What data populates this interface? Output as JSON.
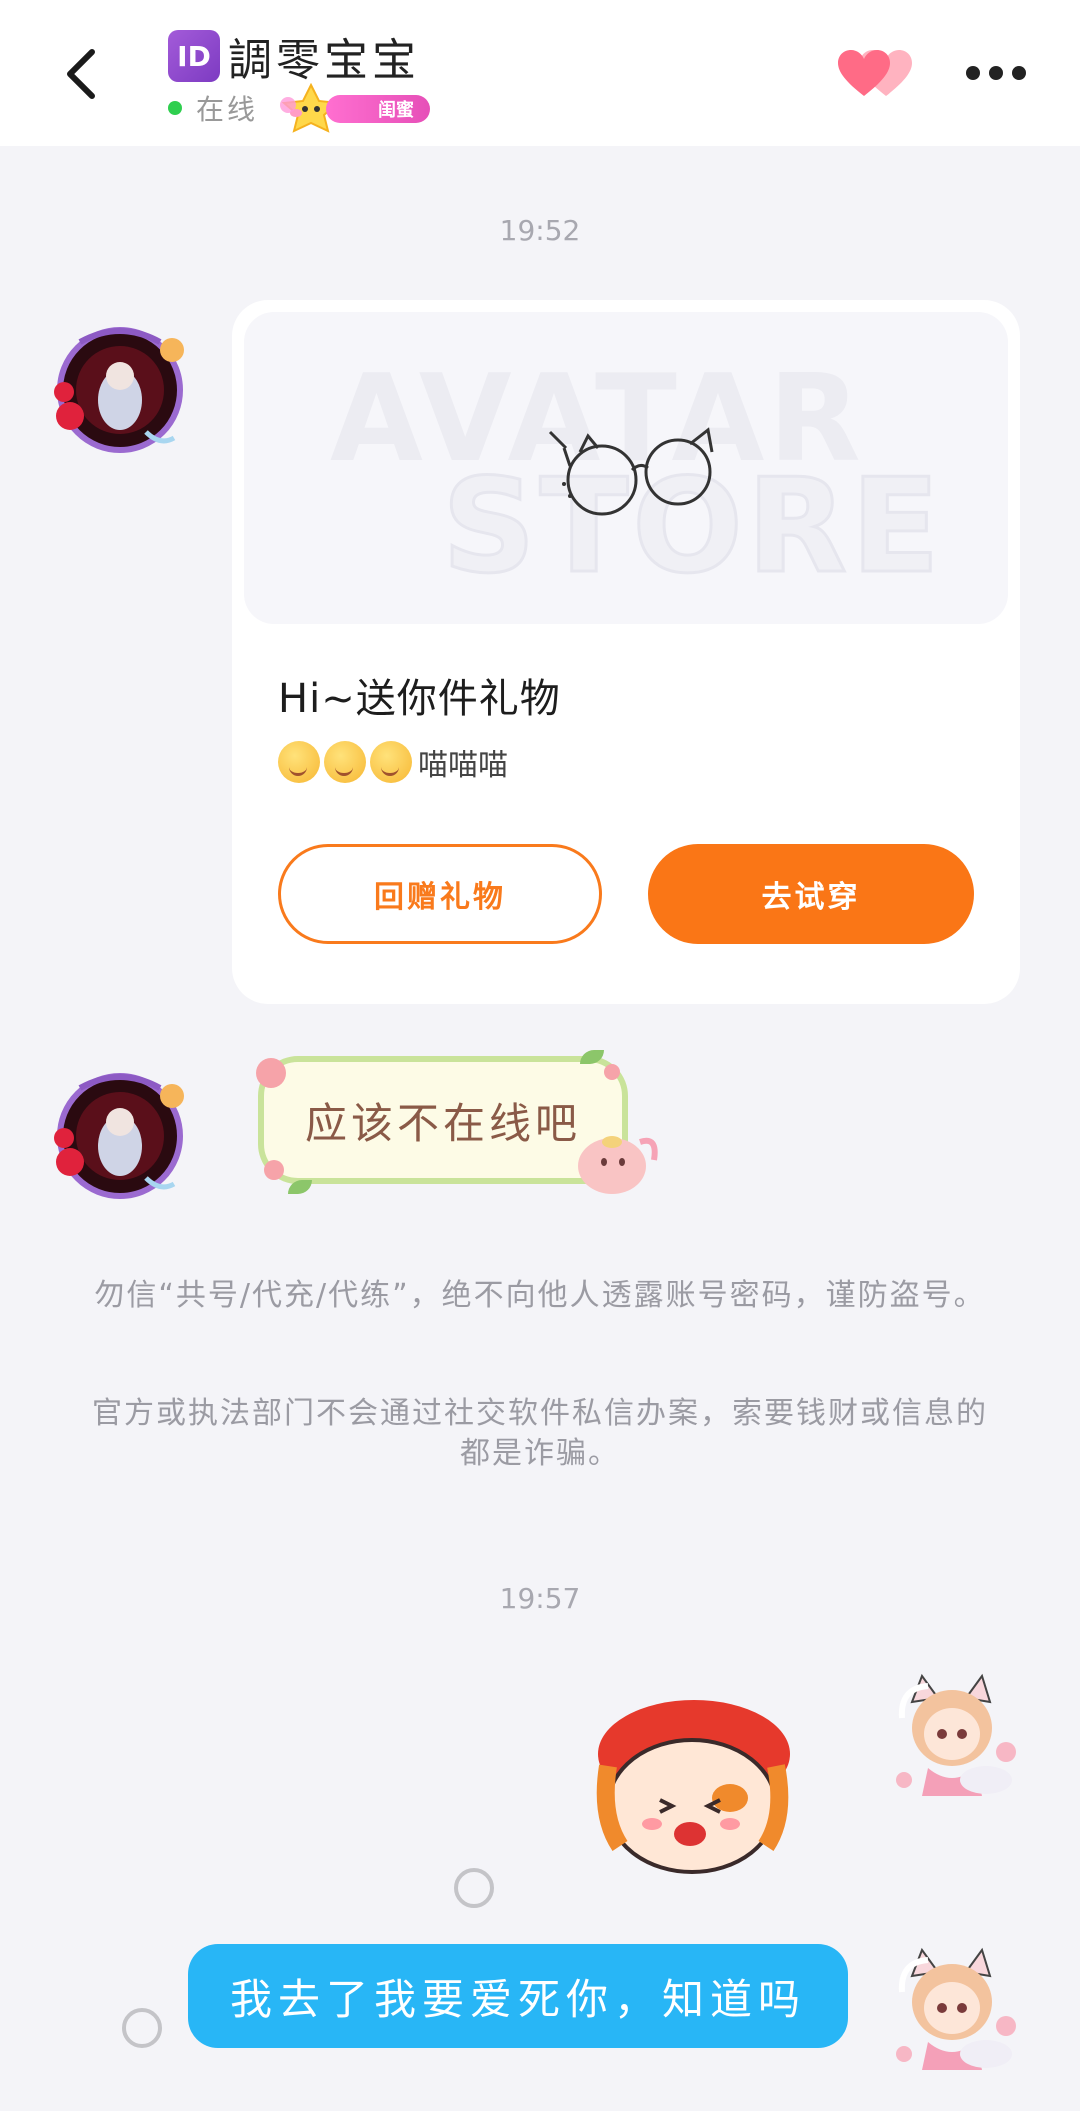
{
  "header": {
    "id_badge": "ID",
    "title": "調零宝宝",
    "status": "在线",
    "relation_badge": "闺蜜"
  },
  "messages": {
    "time_1": "19:52",
    "gift": {
      "watermark_1": "AVATAR",
      "watermark_2": "STORE",
      "title": "Hi~送你件礼物",
      "subtitle": "喵喵喵",
      "return_label": "回赠礼物",
      "try_label": "去试穿"
    },
    "text_1": "应该不在线吧",
    "notice_1": "勿信“共号/代充/代练”，绝不向他人透露账号密码，谨防盗号。",
    "notice_2": "官方或执法部门不会通过社交软件私信办案，索要钱财或信息的都是诈骗。",
    "time_2": "19:57",
    "text_2": "我去了我要爱死你，知道吗"
  },
  "colors": {
    "accent_orange": "#fa7616",
    "bubble_blue": "#28b6f6",
    "online_green": "#2fcf4f",
    "badge_pink": "#e64fb8"
  },
  "icons": [
    "back-icon",
    "double-heart-icon",
    "more-icon",
    "glasses-icon",
    "emoji-icon",
    "star-icon"
  ]
}
